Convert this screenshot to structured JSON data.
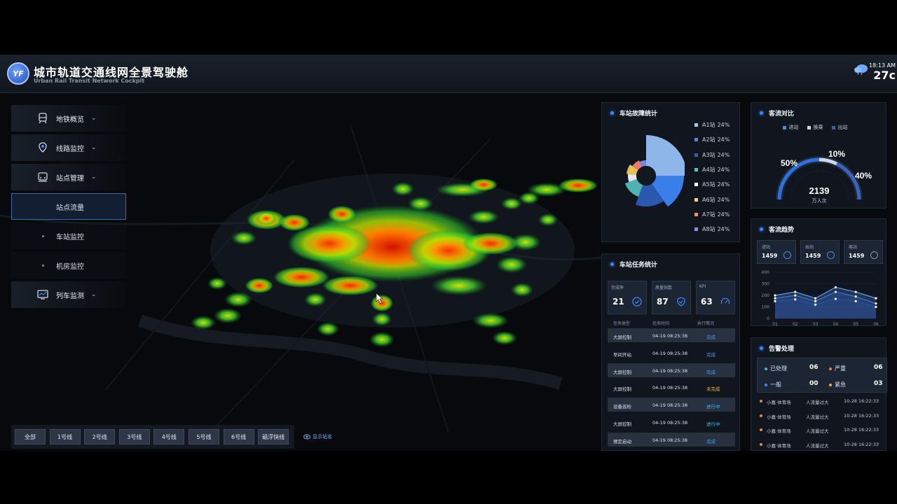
{
  "header": {
    "logo_text": "YF",
    "title": "城市轨道交通线网全景驾驶舱",
    "subtitle": "Urban Rail Transit Network Cockpit",
    "time": "18:13 AM",
    "temperature": "27c",
    "weather_icon": "cloud-rain-icon"
  },
  "sidebar": {
    "items": [
      {
        "label": "地铁概览",
        "icon": "metro-train-icon",
        "expanded": false
      },
      {
        "label": "线路监控",
        "icon": "location-pin-icon",
        "expanded": false
      },
      {
        "label": "站点管理",
        "icon": "station-train-icon",
        "expanded": true
      },
      {
        "label": "列车监测",
        "icon": "monitor-chart-icon",
        "expanded": false
      }
    ],
    "sub_items": [
      {
        "label": "站点流量",
        "active": true
      },
      {
        "label": "车站监控",
        "active": false
      },
      {
        "label": "机房监控",
        "active": false
      }
    ]
  },
  "line_filter": {
    "buttons": [
      "全部",
      "1号线",
      "2号线",
      "3号线",
      "4号线",
      "5号线",
      "6号线",
      "磁浮快线"
    ],
    "show_names_label": "显示站名"
  },
  "fault_panel": {
    "title": "车站故障统计",
    "items": [
      {
        "name": "A1站",
        "value": "24%",
        "color": "#9cc8ff"
      },
      {
        "name": "A2站",
        "value": "24%",
        "color": "#3f8bff"
      },
      {
        "name": "A3站",
        "value": "24%",
        "color": "#2f5fbf"
      },
      {
        "name": "A4站",
        "value": "24%",
        "color": "#56c4c2"
      },
      {
        "name": "A5站",
        "value": "24%",
        "color": "#ffffff"
      },
      {
        "name": "A6站",
        "value": "24%",
        "color": "#ffd35c"
      },
      {
        "name": "A7站",
        "value": "24%",
        "color": "#ff8a6a"
      },
      {
        "name": "A8站",
        "value": "24%",
        "color": "#8b8ff5"
      }
    ]
  },
  "task_panel": {
    "title": "车站任务统计",
    "kpis": [
      {
        "label": "完成率",
        "value": "21",
        "icon": "check-circle-icon"
      },
      {
        "label": "质量指数",
        "value": "87",
        "icon": "shield-check-icon"
      },
      {
        "label": "KPI",
        "value": "63",
        "icon": "gauge-icon"
      }
    ],
    "columns": [
      "任务类型",
      "任务时间",
      "执行情况"
    ],
    "rows": [
      {
        "type": "大屏控制",
        "time": "04-19 08:25:38",
        "status": "完成",
        "color": "#3f9bff"
      },
      {
        "type": "早间开站",
        "time": "04-19 08:25:38",
        "status": "完成",
        "color": "#3f9bff"
      },
      {
        "type": "大屏控制",
        "time": "04-19 08:25:38",
        "status": "完成",
        "color": "#3f9bff"
      },
      {
        "type": "大屏控制",
        "time": "04-19 08:25:38",
        "status": "未完成",
        "color": "#f2b23c"
      },
      {
        "type": "设备巡检",
        "time": "04-19 08:25:38",
        "status": "进行中",
        "color": "#3fb8ff"
      },
      {
        "type": "大屏控制",
        "time": "04-19 08:25:38",
        "status": "进行中",
        "color": "#3fb8ff"
      },
      {
        "type": "预定启动",
        "time": "04-19 08:25:38",
        "status": "完成",
        "color": "#3f9bff"
      }
    ]
  },
  "flow_panel": {
    "title": "客流对比",
    "legend": [
      {
        "label": "进站",
        "color": "#3f8bff"
      },
      {
        "label": "换乘",
        "color": "#cfd8e6"
      },
      {
        "label": "出站",
        "color": "#2f5fbf"
      }
    ],
    "pct_left": "50%",
    "pct_top": "10%",
    "pct_right": "40%",
    "total": "2139",
    "unit": "万人次"
  },
  "trend_panel": {
    "title": "客流趋势",
    "boxes": [
      {
        "label": "进站",
        "value": "1459"
      },
      {
        "label": "出站",
        "value": "1459"
      },
      {
        "label": "客站",
        "value": "1459"
      }
    ],
    "chart_data": {
      "type": "area",
      "x": [
        "01",
        "02",
        "03",
        "04",
        "05",
        "06"
      ],
      "yticks": [
        "400",
        "300",
        "200",
        "100",
        "0"
      ],
      "ylim": [
        0,
        400
      ],
      "series": [
        {
          "values": [
            200,
            230,
            175,
            270,
            230,
            175
          ],
          "color": "#5ea0ff"
        },
        {
          "values": [
            175,
            200,
            150,
            230,
            190,
            130
          ],
          "color": "#3b73d9"
        },
        {
          "values": [
            150,
            165,
            120,
            170,
            150,
            100
          ],
          "color": "#2a4fa8"
        }
      ]
    }
  },
  "alarm_panel": {
    "title": "告警处理",
    "summary": [
      {
        "label": "已处理",
        "value": "06",
        "color": "#3fb8c8"
      },
      {
        "label": "严重",
        "value": "06",
        "color": "#f27a3c"
      },
      {
        "label": "一般",
        "value": "00",
        "color": "#3f8bff"
      },
      {
        "label": "紧急",
        "value": "03",
        "color": "#f2b23c"
      }
    ],
    "rows": [
      {
        "station": "小嘉·体育场",
        "message": "人流量过大",
        "time": "10-28 16:22:33"
      },
      {
        "station": "小嘉·体育场",
        "message": "人流量过大",
        "time": "10-28 16:22:33"
      },
      {
        "station": "小嘉·体育场",
        "message": "人流量过大",
        "time": "10-28 16:22:33"
      },
      {
        "station": "小嘉·体育场",
        "message": "人流量过大",
        "time": "10-28 16:22:33"
      }
    ]
  }
}
